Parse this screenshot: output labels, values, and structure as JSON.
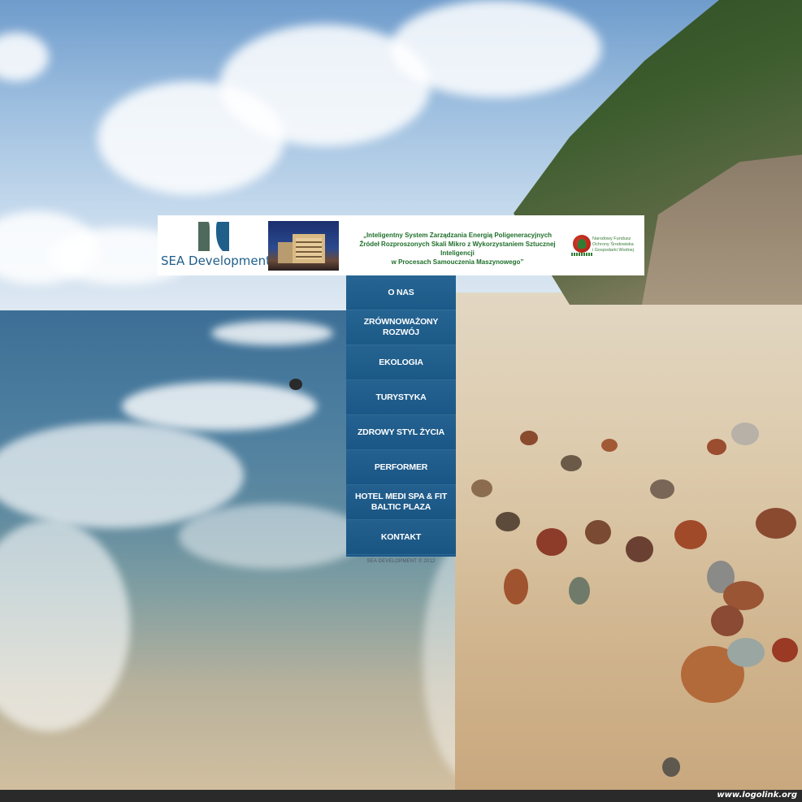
{
  "banner": {
    "logo_text": "SEA Development",
    "project_title": [
      "„Inteligentny System Zarządzania Energią Poligeneracyjnych",
      "Źródeł Rozproszonych Skali Mikro z Wykorzystaniem Sztucznej Inteligencji",
      "w Procesach Samouczenia Maszynowego”"
    ],
    "fund_name": [
      "Narodowy Fundusz",
      "Ochrony Środowiska",
      "i Gospodarki Wodnej"
    ]
  },
  "nav": {
    "items": [
      {
        "label": "O NAS"
      },
      {
        "label": "ZRÓWNOWAŻONY ROZWÓJ"
      },
      {
        "label": "EKOLOGIA"
      },
      {
        "label": "TURYSTYKA"
      },
      {
        "label": "ZDROWY STYL ŻYCIA"
      },
      {
        "label": "PERFORMER"
      },
      {
        "label": "HOTEL MEDI SPA & FIT BALTIC PLAZA"
      },
      {
        "label": "KONTAKT"
      }
    ]
  },
  "footer": {
    "copyright": "SEA DEVELOPMENT © 2012",
    "watermark": "www.logolink.org"
  },
  "colors": {
    "nav_bg": "#1d5f8f",
    "logo_blue": "#1f5f8a",
    "project_green": "#1e6f2a",
    "fund_red": "#d73a2a"
  }
}
